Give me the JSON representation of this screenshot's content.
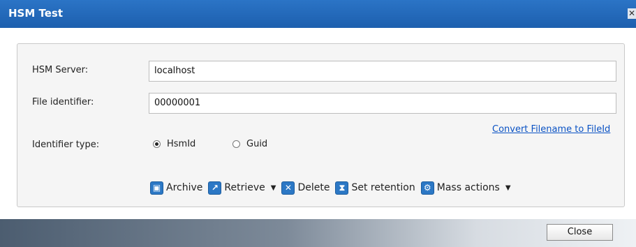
{
  "window": {
    "title": "HSM Test",
    "close_glyph": "✕"
  },
  "form": {
    "server_label": "HSM Server:",
    "server_value": "localhost",
    "file_id_label": "File identifier:",
    "file_id_value": "00000001",
    "identifier_type_label": "Identifier type:",
    "radio_options": [
      {
        "label": "HsmId",
        "selected": true
      },
      {
        "label": "Guid",
        "selected": false
      }
    ],
    "convert_link": "Convert Filename to FileId"
  },
  "toolbar": {
    "archive": "Archive",
    "retrieve": "Retrieve",
    "delete": "Delete",
    "set_retention": "Set retention",
    "mass_actions": "Mass actions"
  },
  "footer": {
    "close_label": "Close"
  }
}
